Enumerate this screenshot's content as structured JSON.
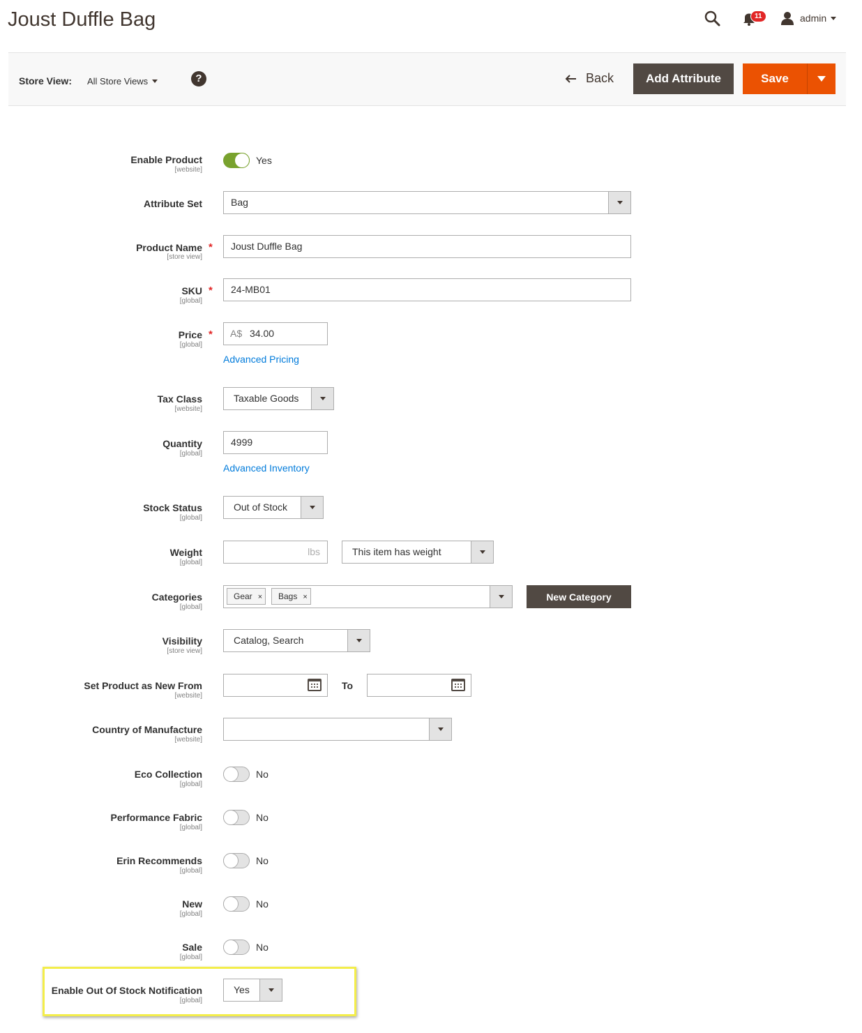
{
  "header": {
    "title": "Joust Duffle Bag",
    "notifications_count": "11",
    "user_name": "admin"
  },
  "actionbar": {
    "store_view_label": "Store View:",
    "store_view_value": "All Store Views",
    "help_glyph": "?",
    "back_label": "Back",
    "add_attribute_label": "Add Attribute",
    "save_label": "Save"
  },
  "form": {
    "enable_product": {
      "label": "Enable Product",
      "scope": "[website]",
      "state": "Yes"
    },
    "attribute_set": {
      "label": "Attribute Set",
      "value": "Bag"
    },
    "product_name": {
      "label": "Product Name",
      "scope": "[store view]",
      "value": "Joust Duffle Bag"
    },
    "sku": {
      "label": "SKU",
      "scope": "[global]",
      "value": "24-MB01"
    },
    "price": {
      "label": "Price",
      "scope": "[global]",
      "currency": "A$",
      "value": "34.00",
      "link": "Advanced Pricing"
    },
    "tax_class": {
      "label": "Tax Class",
      "scope": "[website]",
      "value": "Taxable Goods"
    },
    "quantity": {
      "label": "Quantity",
      "scope": "[global]",
      "value": "4999",
      "link": "Advanced Inventory"
    },
    "stock_status": {
      "label": "Stock Status",
      "scope": "[global]",
      "value": "Out of Stock"
    },
    "weight": {
      "label": "Weight",
      "scope": "[global]",
      "unit": "lbs",
      "option": "This item has weight"
    },
    "categories": {
      "label": "Categories",
      "scope": "[global]",
      "tags": [
        "Gear",
        "Bags"
      ],
      "tag_remove_glyph": "×",
      "new_category_label": "New Category"
    },
    "visibility": {
      "label": "Visibility",
      "scope": "[store view]",
      "value": "Catalog, Search"
    },
    "new_from": {
      "label": "Set Product as New From",
      "scope": "[website]",
      "to_label": "To"
    },
    "country": {
      "label": "Country of Manufacture",
      "scope": "[website]",
      "value": ""
    },
    "eco_collection": {
      "label": "Eco Collection",
      "scope": "[global]",
      "state": "No"
    },
    "performance_fabric": {
      "label": "Performance Fabric",
      "scope": "[global]",
      "state": "No"
    },
    "erin_recommends": {
      "label": "Erin Recommends",
      "scope": "[global]",
      "state": "No"
    },
    "new": {
      "label": "New",
      "scope": "[global]",
      "state": "No"
    },
    "sale": {
      "label": "Sale",
      "scope": "[global]",
      "state": "No"
    },
    "out_of_stock_notification": {
      "label": "Enable Out Of Stock Notification",
      "scope": "[global]",
      "value": "Yes"
    }
  },
  "required_mark": "*",
  "colors": {
    "accent": "#eb5202",
    "dark_button": "#514943",
    "toggle_on": "#79a22e",
    "link": "#007bdb",
    "highlight": "#f3ed4a"
  }
}
